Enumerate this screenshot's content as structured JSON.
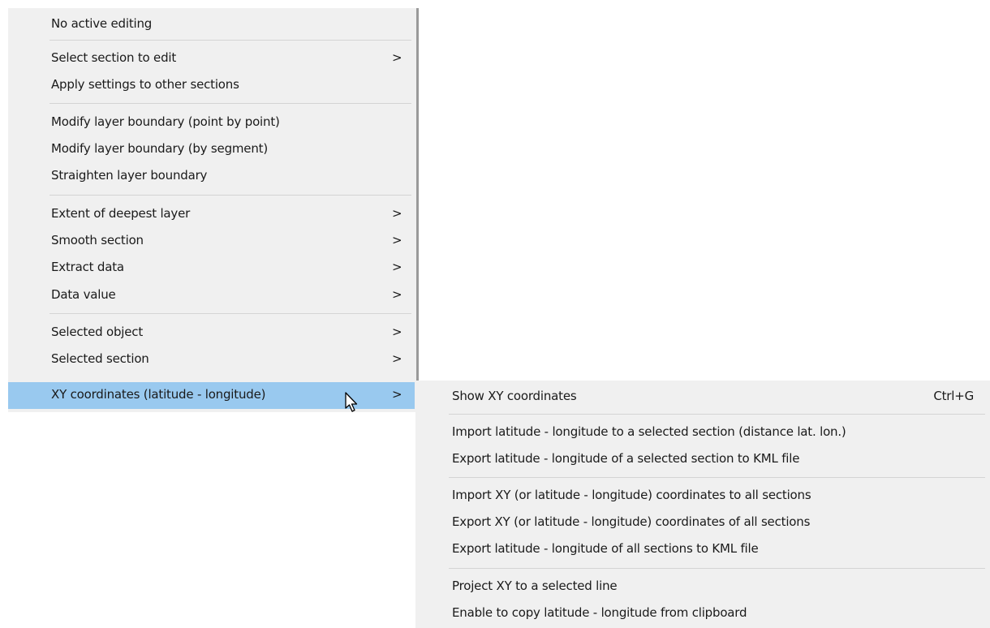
{
  "main_menu": {
    "items": [
      {
        "label": "No active editing",
        "arrow": ""
      },
      {
        "label": "Select section to edit",
        "arrow": ">"
      },
      {
        "label": "Apply settings to other sections",
        "arrow": ""
      },
      {
        "label": "Modify layer boundary (point by point)",
        "arrow": ""
      },
      {
        "label": "Modify layer boundary (by segment)",
        "arrow": ""
      },
      {
        "label": "Straighten layer boundary",
        "arrow": ""
      },
      {
        "label": "Extent of deepest layer",
        "arrow": ">"
      },
      {
        "label": "Smooth section",
        "arrow": ">"
      },
      {
        "label": "Extract data",
        "arrow": ">"
      },
      {
        "label": "Data value",
        "arrow": ">"
      },
      {
        "label": "Selected object",
        "arrow": ">"
      },
      {
        "label": "Selected section",
        "arrow": ">"
      },
      {
        "label": "XY coordinates (latitude - longitude)",
        "arrow": ">",
        "highlighted": true
      }
    ]
  },
  "sub_menu": {
    "items": [
      {
        "label": "Show XY coordinates",
        "shortcut": "Ctrl+G"
      },
      {
        "label": "Import latitude - longitude to a selected section (distance lat. lon.)",
        "shortcut": ""
      },
      {
        "label": "Export latitude - longitude of a selected section to KML file",
        "shortcut": ""
      },
      {
        "label": "Import XY (or latitude - longitude) coordinates to all sections",
        "shortcut": ""
      },
      {
        "label": "Export XY (or latitude - longitude) coordinates of all sections",
        "shortcut": ""
      },
      {
        "label": "Export latitude - longitude of all sections to KML file",
        "shortcut": ""
      },
      {
        "label": "Project XY to a selected line",
        "shortcut": ""
      },
      {
        "label": "Enable to copy latitude - longitude from clipboard",
        "shortcut": ""
      }
    ]
  },
  "colors": {
    "menu_background": "#f0f0f0",
    "highlight": "#99c9ef",
    "separator": "#d4d4d4",
    "text": "#1a1a1a"
  },
  "icons": {
    "cursor": "mouse-pointer-icon",
    "submenu_arrow": "chevron-right-icon"
  }
}
